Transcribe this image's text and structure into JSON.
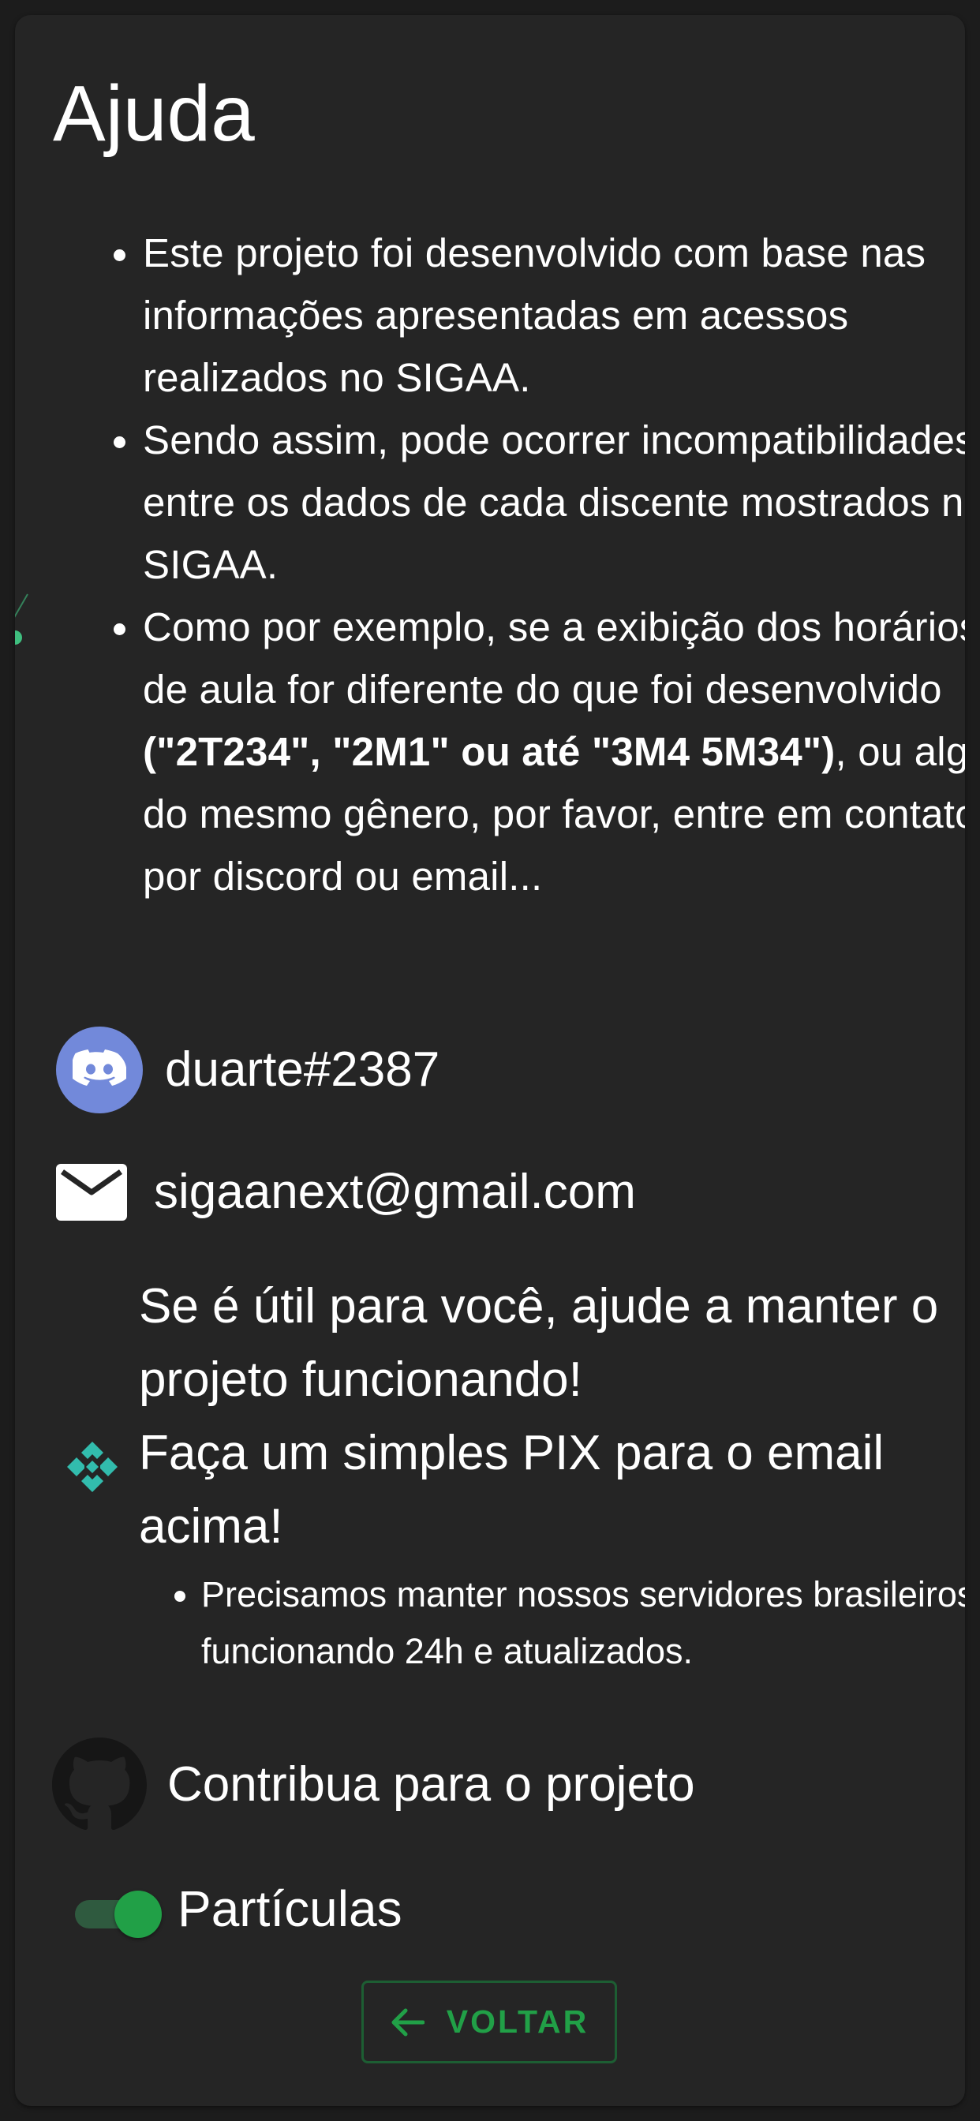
{
  "page": {
    "title": "Ajuda"
  },
  "info": {
    "item1": "Este projeto foi desenvolvido com base nas informações apresentadas em acessos realizados no SIGAA.",
    "item2": "Sendo assim, pode ocorrer incompatibilidades entre os dados de cada discente mostrados no SIGAA.",
    "item3_before": "Como por exemplo, se a exibição dos horários de aula for diferente do que foi desenvolvido ",
    "item3_bold": "(\"2T234\", \"2M1\" ou até \"3M4 5M34\")",
    "item3_after": ", ou algo do mesmo gênero, por favor, entre em contato por discord ou email..."
  },
  "contacts": {
    "discord": "duarte#2387",
    "email": "sigaanext@gmail.com"
  },
  "donation": {
    "line1": "Se é útil para você, ajude a manter o projeto funcionando!",
    "line2": "Faça um simples PIX para o email acima!",
    "note": "Precisamos manter nossos servidores brasileiros funcionando 24h e atualizados."
  },
  "github": {
    "label": "Contribua para o projeto"
  },
  "particles": {
    "label": "Partículas",
    "enabled": true
  },
  "back_button": {
    "label": "VOLTAR"
  },
  "colors": {
    "background": "#1c1c1c",
    "card": "#252525",
    "accent_green": "#21a047",
    "discord_blue": "#7289da",
    "pix_teal": "#32bcad"
  }
}
